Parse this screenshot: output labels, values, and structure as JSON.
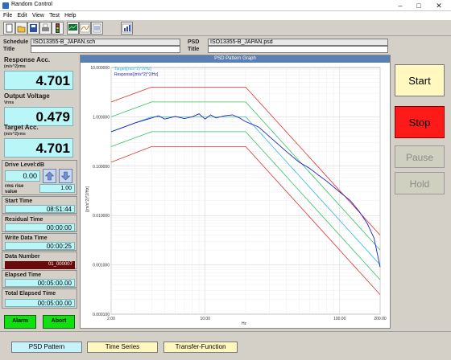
{
  "app": {
    "title": "Random Control"
  },
  "menu": [
    "File",
    "Edit",
    "View",
    "Test",
    "Help"
  ],
  "toolbar": {
    "icons": [
      "new-icon",
      "open-icon",
      "save-icon",
      "print-icon",
      "traffic-light-icon",
      "monitor-icon",
      "chart-icon",
      "list-icon",
      "report-icon"
    ]
  },
  "header": {
    "schedule_label": "Schedule",
    "schedule_value": "ISO13355-B_JAPAN.sch",
    "title_label": "Title",
    "title_value": "",
    "psd_label": "PSD",
    "psd_value": "ISO13355-B_JAPAN.psd",
    "title2_label": "Title",
    "title2_value": ""
  },
  "left": {
    "response_label": "Response Acc.",
    "response_unit": "(m/s^2)rms",
    "response_value": "4.701",
    "output_label": "Output Voltage",
    "output_unit": "Vrms",
    "output_value": "0.479",
    "target_label": "Target Acc.",
    "target_unit": "(m/s^2)rms",
    "target_value": "4.701",
    "drive_label": "Drive Level:dB",
    "drive_value": "0.00",
    "rms_rise_label_1": "rms rise",
    "rms_rise_label_2": "value",
    "rms_rise_value": "1.00",
    "start_label": "Start Time",
    "start_value": "08:51:44",
    "residual_label": "Residual Time",
    "residual_value": "00:00:00",
    "write_label": "Write Data Time",
    "write_value": "00:00:25",
    "datanum_label": "Data Number",
    "datanum_value": "01_000007",
    "elapsed_label": "Elapsed Time",
    "elapsed_value": "00:05:00.00",
    "total_label": "Total Elapsed Time",
    "total_value": "00:05:00.00",
    "alarm_label": "Alarm",
    "abort_label": "Abort"
  },
  "controls": {
    "start": "Start",
    "stop": "Stop",
    "pause": "Pause",
    "hold": "Hold"
  },
  "tabs": [
    "PSD Pattern",
    "Time Series",
    "Transfer-Function"
  ],
  "chart_data": {
    "type": "line",
    "title": "PSD Pattern Graph",
    "xlabel": "Hz",
    "ylabel": "[(m/s^2)^2/Hz]",
    "xscale": "log",
    "yscale": "log",
    "xlim": [
      2,
      200
    ],
    "ylim": [
      0.0001,
      10
    ],
    "xticks": [
      "2.00",
      "10.00",
      "100.00",
      "200.00"
    ],
    "yticks": [
      "10.000000",
      "1.000000",
      "0.100000",
      "0.010000",
      "0.001000",
      "0.000100"
    ],
    "legend": [
      "Target[(m/s^2)^2/Hz]",
      "Response[(m/s^2)^2/Hz]"
    ],
    "grid": true,
    "series": [
      {
        "name": "Abort upper",
        "color": "#e03030",
        "x": [
          2,
          4,
          20,
          200
        ],
        "y": [
          2.0,
          4.0,
          4.0,
          0.004
        ]
      },
      {
        "name": "Alarm upper",
        "color": "#30c060",
        "x": [
          2,
          4,
          20,
          200
        ],
        "y": [
          1.0,
          2.0,
          2.0,
          0.002
        ]
      },
      {
        "name": "Target[(m/s^2)^2/Hz]",
        "color": "#28b8e8",
        "x": [
          2,
          4,
          20,
          200
        ],
        "y": [
          0.5,
          1.0,
          1.0,
          0.001
        ]
      },
      {
        "name": "Alarm lower",
        "color": "#30c060",
        "x": [
          2,
          4,
          20,
          200
        ],
        "y": [
          0.25,
          0.5,
          0.5,
          0.0005
        ]
      },
      {
        "name": "Abort lower",
        "color": "#e03030",
        "x": [
          2,
          4,
          20,
          200
        ],
        "y": [
          0.12,
          0.25,
          0.25,
          0.00025
        ]
      },
      {
        "name": "Response[(m/s^2)^2/Hz]",
        "color": "#2020c0",
        "x": [
          2,
          2.5,
          3,
          3.5,
          4,
          4.5,
          5,
          6,
          7,
          8,
          9,
          10,
          11,
          12,
          14,
          16,
          18,
          20,
          25,
          30,
          40,
          50,
          60,
          70,
          80,
          100,
          120,
          140,
          160,
          180,
          200
        ],
        "y": [
          0.5,
          0.62,
          0.75,
          0.85,
          0.95,
          1.05,
          0.9,
          1.02,
          0.92,
          1.0,
          1.15,
          0.9,
          1.1,
          0.95,
          1.05,
          1.1,
          0.95,
          0.8,
          0.62,
          0.4,
          0.2,
          0.12,
          0.09,
          0.065,
          0.05,
          0.03,
          0.02,
          0.012,
          0.007,
          0.0035,
          0.0009
        ]
      }
    ]
  }
}
